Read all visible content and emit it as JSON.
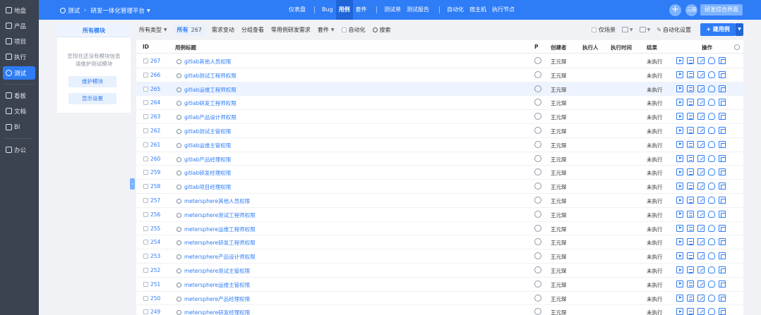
{
  "sidebar": {
    "items": [
      {
        "label": "地盘",
        "icon": "home-icon"
      },
      {
        "label": "产品",
        "icon": "product-icon"
      },
      {
        "label": "项目",
        "icon": "project-icon"
      },
      {
        "label": "执行",
        "icon": "execution-icon"
      },
      {
        "label": "测试",
        "icon": "test-icon",
        "active": true
      },
      {
        "label": "看板",
        "icon": "kanban-icon"
      },
      {
        "label": "文档",
        "icon": "doc-icon"
      },
      {
        "label": "BI",
        "icon": "bi-icon"
      },
      {
        "label": "办公",
        "icon": "office-icon"
      }
    ]
  },
  "topbar": {
    "brand": "测试",
    "separator": "›",
    "product": "研发一体化管理平台",
    "nav": [
      "仪表盘",
      "Bug",
      "用例",
      "套件",
      "测试单",
      "测试报告",
      "自动化",
      "宿主机",
      "执行节点"
    ],
    "active_nav": "用例",
    "avatar": "元琛",
    "right_button": "研发综合界面",
    "plus": "+"
  },
  "left_panel": {
    "title": "所有模块",
    "note_line1": "您现在还没有模块信息",
    "note_line2": "请维护测试模块",
    "btn_maintain": "维护模块",
    "btn_display": "显示设置"
  },
  "toolbar": {
    "all_types": "所有类型",
    "all": "所有",
    "all_count": "267",
    "need_change": "需求变动",
    "group_view": "分组查看",
    "zero_case": "零用例研发需求",
    "suite": "套件",
    "automation": "自动化",
    "search": "搜索",
    "only_scene": "仅场景",
    "auto_settings": "自动化设置",
    "create": "+ 建用例"
  },
  "table": {
    "headers": {
      "id": "ID",
      "title": "用例标题",
      "p": "P",
      "creator": "创建者",
      "executor": "执行人",
      "exec_time": "执行时间",
      "result": "结果",
      "ops": "操作"
    },
    "rows": [
      {
        "id": "267",
        "title": "gitlab其他人员权限",
        "creator": "王元琛",
        "result": "未执行"
      },
      {
        "id": "266",
        "title": "gitlab测试工程师权限",
        "creator": "王元琛",
        "result": "未执行"
      },
      {
        "id": "265",
        "title": "gitlab运维工程师权限",
        "creator": "王元琛",
        "result": "未执行"
      },
      {
        "id": "264",
        "title": "gitlab研发工程师权限",
        "creator": "王元琛",
        "result": "未执行"
      },
      {
        "id": "263",
        "title": "gitlab产品设计师权限",
        "creator": "王元琛",
        "result": "未执行"
      },
      {
        "id": "262",
        "title": "gitlab测试主管权限",
        "creator": "王元琛",
        "result": "未执行"
      },
      {
        "id": "261",
        "title": "gitlab运维主管权限",
        "creator": "王元琛",
        "result": "未执行"
      },
      {
        "id": "260",
        "title": "gitlab产品经理权限",
        "creator": "王元琛",
        "result": "未执行"
      },
      {
        "id": "259",
        "title": "gitlab研发经理权限",
        "creator": "王元琛",
        "result": "未执行"
      },
      {
        "id": "258",
        "title": "gitlab项目经理权限",
        "creator": "王元琛",
        "result": "未执行"
      },
      {
        "id": "257",
        "title": "metersphere其他人员权限",
        "creator": "王元琛",
        "result": "未执行"
      },
      {
        "id": "256",
        "title": "metersphere测试工程师权限",
        "creator": "王元琛",
        "result": "未执行"
      },
      {
        "id": "255",
        "title": "metersphere运维工程师权限",
        "creator": "王元琛",
        "result": "未执行"
      },
      {
        "id": "254",
        "title": "metersphere研发工程师权限",
        "creator": "王元琛",
        "result": "未执行"
      },
      {
        "id": "253",
        "title": "metersphere产品设计师权限",
        "creator": "王元琛",
        "result": "未执行"
      },
      {
        "id": "252",
        "title": "metersphere测试主管权限",
        "creator": "王元琛",
        "result": "未执行"
      },
      {
        "id": "251",
        "title": "metersphere运维主管权限",
        "creator": "王元琛",
        "result": "未执行"
      },
      {
        "id": "250",
        "title": "metersphere产品经理权限",
        "creator": "王元琛",
        "result": "未执行"
      },
      {
        "id": "249",
        "title": "metersphere研发经理权限",
        "creator": "王元琛",
        "result": "未执行"
      }
    ]
  },
  "colors": {
    "primary": "#2e7cf6",
    "sidebar": "#3b4350",
    "highlight_row": "#eef4ff"
  }
}
